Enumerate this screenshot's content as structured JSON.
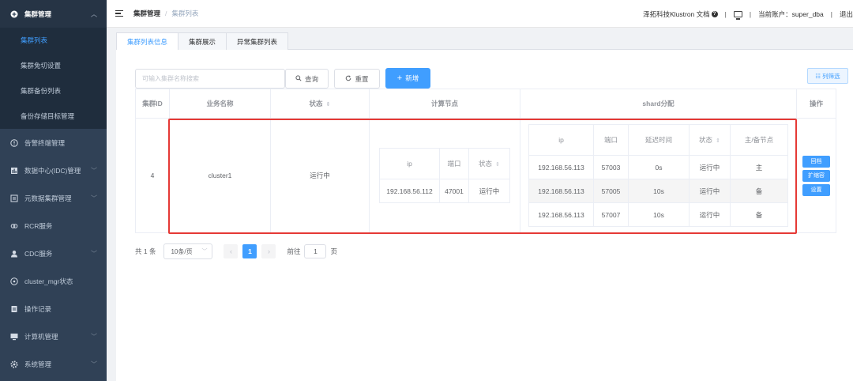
{
  "sidebar": {
    "group_open": {
      "label": "集群管理",
      "icon": "plus-circle-icon"
    },
    "sub_items": [
      {
        "label": "集群列表",
        "active": true
      },
      {
        "label": "集群免切设置"
      },
      {
        "label": "集群备份列表"
      },
      {
        "label": "备份存储目标管理"
      }
    ],
    "groups": [
      {
        "label": "告警终端管理",
        "icon": "info-circle-icon",
        "chevron": false
      },
      {
        "label": "数据中心(IDC)管理",
        "icon": "chart-bar-icon",
        "chevron": true
      },
      {
        "label": "元数据集群管理",
        "icon": "document-icon",
        "chevron": true
      },
      {
        "label": "RCR服务",
        "icon": "link-icon",
        "chevron": false
      },
      {
        "label": "CDC服务",
        "icon": "user-icon",
        "chevron": true
      },
      {
        "label": "cluster_mgr状态",
        "icon": "compass-icon",
        "chevron": false
      },
      {
        "label": "操作记录",
        "icon": "clipboard-icon",
        "chevron": false
      },
      {
        "label": "计算机管理",
        "icon": "monitor-icon",
        "chevron": true
      },
      {
        "label": "系统管理",
        "icon": "gear-icon",
        "chevron": true
      }
    ]
  },
  "header": {
    "breadcrumb": [
      "集群管理",
      "集群列表"
    ],
    "docs_link": "泽拓科技Klustron 文档",
    "account_label": "当前账户：super_dba",
    "logout": "退出"
  },
  "tabs": [
    {
      "label": "集群列表信息",
      "active": true
    },
    {
      "label": "集群展示"
    },
    {
      "label": "异常集群列表"
    }
  ],
  "toolbar": {
    "search_placeholder": "可输入集群名称搜索",
    "query_label": "查询",
    "reset_label": "重置",
    "add_label": "新增",
    "filter_label": "列筛选"
  },
  "table": {
    "headers": {
      "id": "集群ID",
      "name": "业务名称",
      "status": "状态",
      "compute": "计算节点",
      "shard": "shard分配",
      "ops": "操作"
    },
    "row": {
      "id": "4",
      "name": "cluster1",
      "status": "运行中",
      "compute": {
        "headers": [
          "ip",
          "端口",
          "状态"
        ],
        "rows": [
          {
            "ip": "192.168.56.112",
            "port": "47001",
            "status": "运行中"
          }
        ]
      },
      "shard": {
        "headers": [
          "ip",
          "端口",
          "延迟时间",
          "状态",
          "主/备节点"
        ],
        "rows": [
          {
            "ip": "192.168.56.113",
            "port": "57003",
            "delay": "0s",
            "status": "运行中",
            "role": "主"
          },
          {
            "ip": "192.168.56.113",
            "port": "57005",
            "delay": "10s",
            "status": "运行中",
            "role": "备"
          },
          {
            "ip": "192.168.56.113",
            "port": "57007",
            "delay": "10s",
            "status": "运行中",
            "role": "备"
          }
        ]
      },
      "ops": [
        "回档",
        "扩缩容",
        "设置"
      ]
    }
  },
  "pagination": {
    "total": "共 1 条",
    "page_size": "10条/页",
    "current_page": "1",
    "goto_label": "前往",
    "goto_value": "1",
    "page_unit": "页"
  },
  "colors": {
    "primary": "#409eff",
    "success": "#67c23a",
    "sidebar": "#304156",
    "highlight": "#e53935"
  }
}
